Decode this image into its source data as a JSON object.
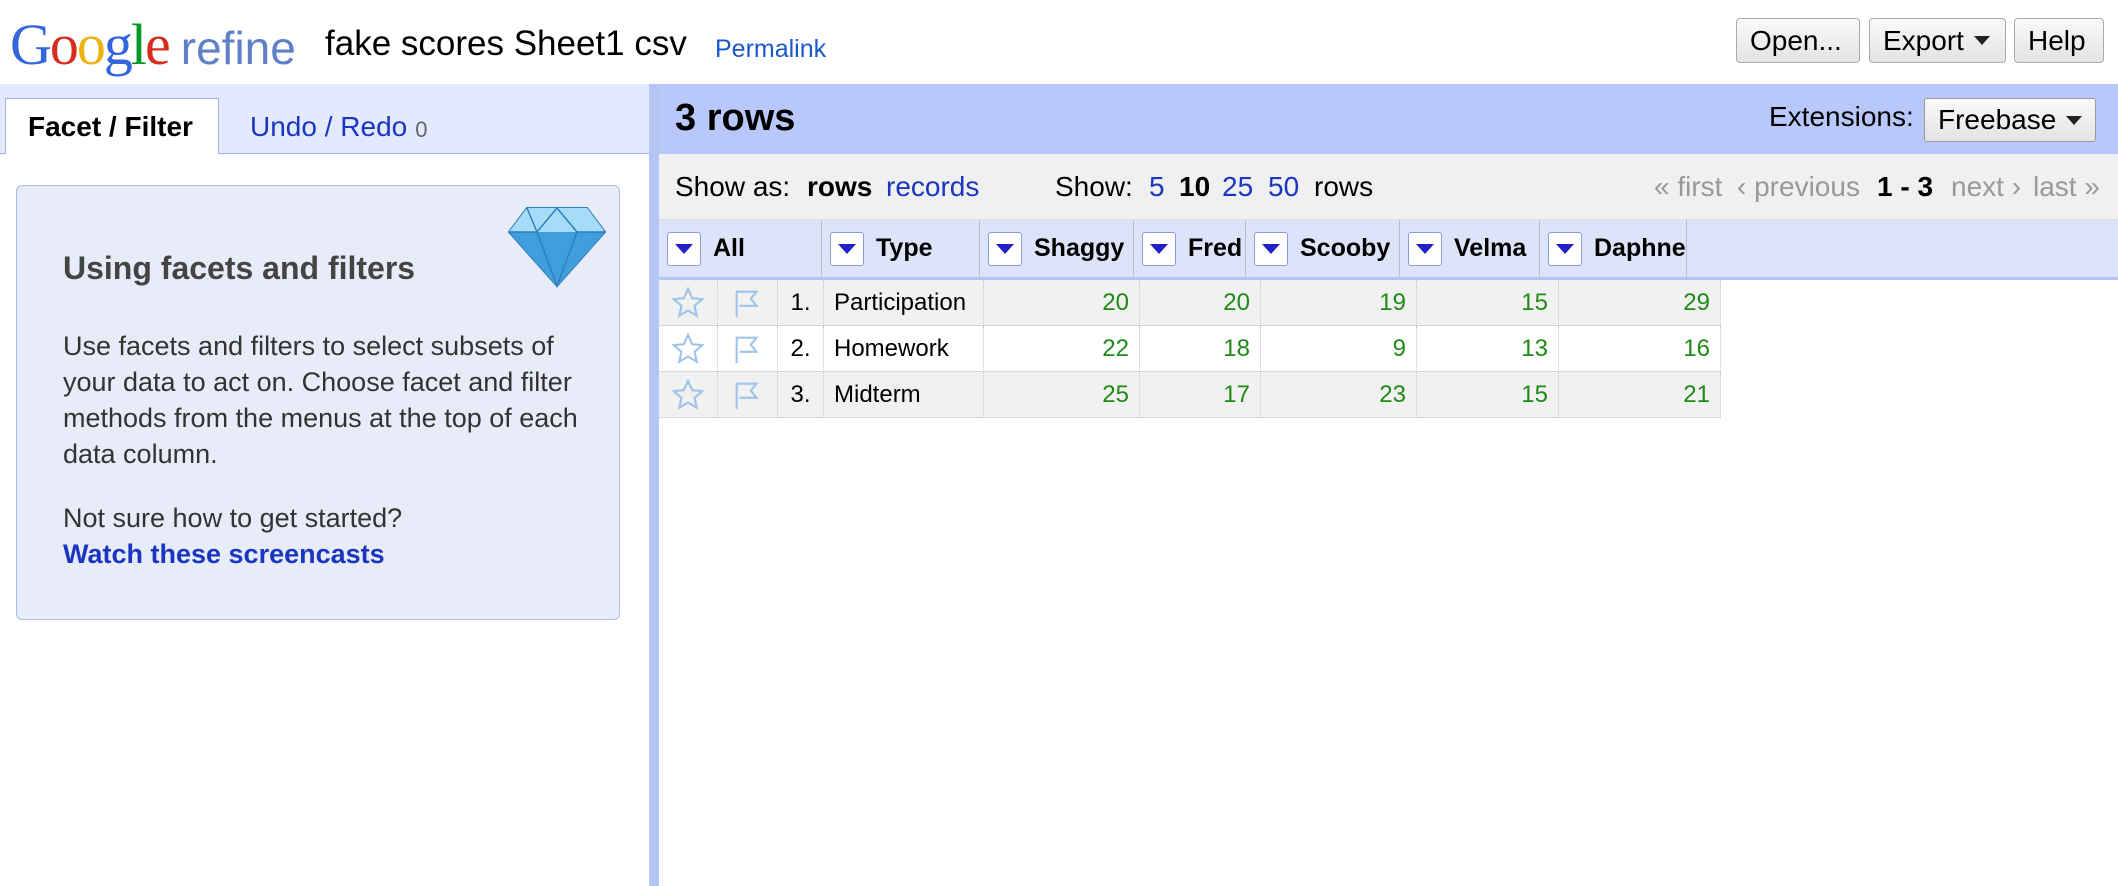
{
  "header": {
    "logo_letters": [
      "G",
      "o",
      "o",
      "g",
      "l",
      "e"
    ],
    "logo_product": "refine",
    "project_title": "fake scores Sheet1 csv",
    "permalink": "Permalink",
    "buttons": {
      "open": "Open...",
      "export": "Export",
      "help": "Help"
    }
  },
  "left_panel": {
    "tabs": {
      "facet_filter": "Facet / Filter",
      "undo_redo": "Undo / Redo",
      "undo_count": "0"
    },
    "help": {
      "title": "Using facets and filters",
      "body": "Use facets and filters to select subsets of your data to act on. Choose facet and filter methods from the menus at the top of each data column.",
      "question": "Not sure how to get started?",
      "link": "Watch these screencasts",
      "icon": "diamond-icon"
    }
  },
  "right_panel": {
    "row_count": "3 rows",
    "extensions_label": "Extensions:",
    "extensions_button": "Freebase",
    "view": {
      "show_as_label": "Show as:",
      "rows_mode": "rows",
      "records_mode": "records",
      "show_label": "Show:",
      "page_sizes": [
        "5",
        "10",
        "25",
        "50"
      ],
      "page_size_selected": "10",
      "rows_suffix": "rows",
      "first": "« first",
      "previous": "‹ previous",
      "range": "1 - 3",
      "next": "next ›",
      "last": "last »"
    },
    "columns": [
      "All",
      "Type",
      "Shaggy",
      "Fred",
      "Scooby",
      "Velma",
      "Daphne"
    ],
    "rows": [
      {
        "index": "1.",
        "type": "Participation",
        "values": [
          "20",
          "20",
          "19",
          "15",
          "29"
        ]
      },
      {
        "index": "2.",
        "type": "Homework",
        "values": [
          "22",
          "18",
          "9",
          "13",
          "16"
        ]
      },
      {
        "index": "3.",
        "type": "Midterm",
        "values": [
          "25",
          "17",
          "23",
          "15",
          "21"
        ]
      }
    ]
  },
  "colors": {
    "accent_blue": "#b8c8fb",
    "link": "#1a35c0",
    "number_green": "#1f8a16"
  }
}
